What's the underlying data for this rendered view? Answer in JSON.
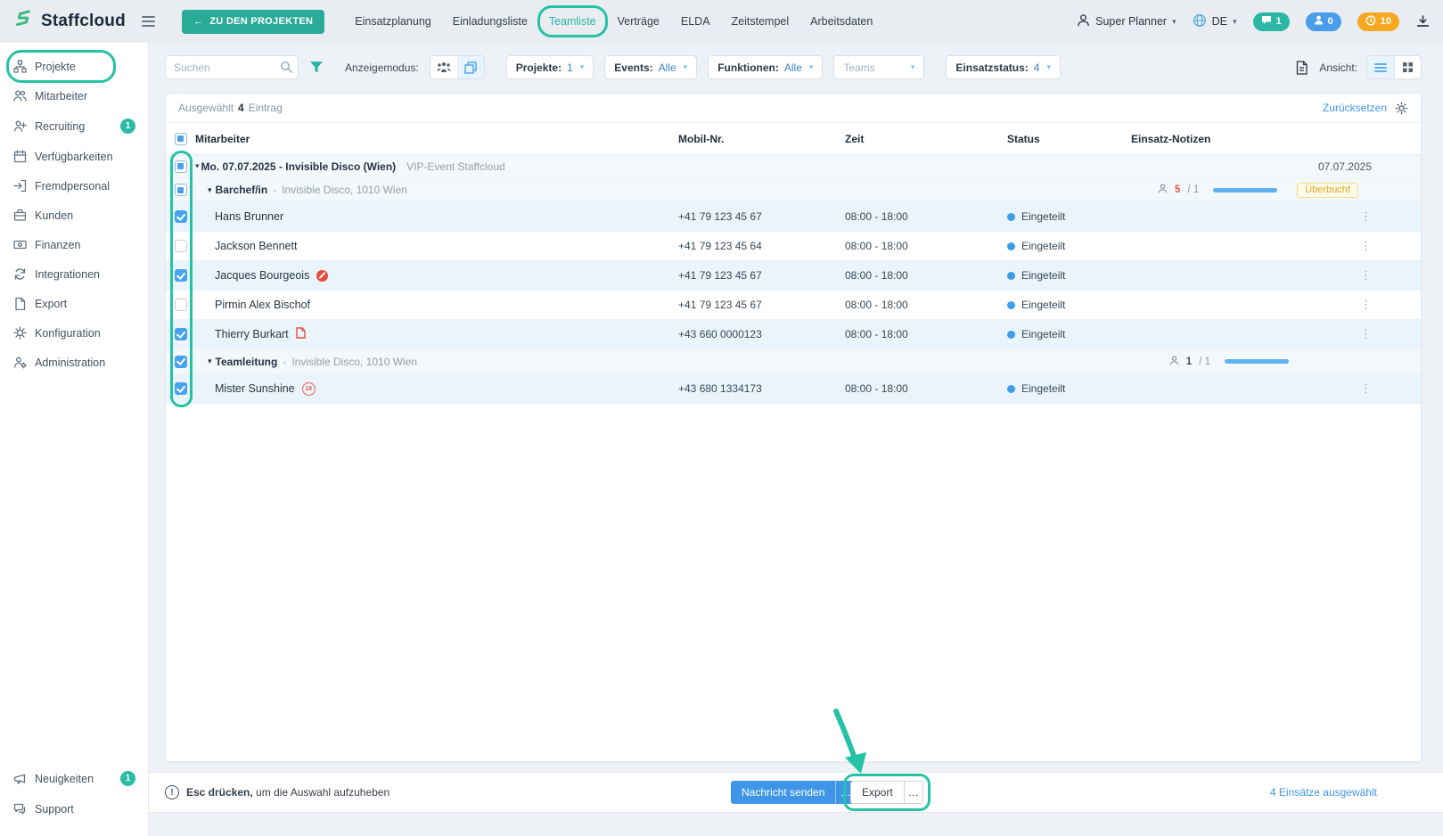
{
  "colors": {
    "accent_teal": "#27b9a3",
    "accent_blue": "#3f96e8",
    "accent_orange": "#f6a623",
    "annotation": "#25c2a5",
    "status_dot": "#3e9de8",
    "danger": "#e45c49"
  },
  "topbar": {
    "brand": "Staffcloud",
    "back_button": "ZU DEN PROJEKTEN",
    "tabs": [
      {
        "label": "Einsatzplanung"
      },
      {
        "label": "Einladungsliste"
      },
      {
        "label": "Teamliste"
      },
      {
        "label": "Verträge"
      },
      {
        "label": "ELDA"
      },
      {
        "label": "Zeitstempel"
      },
      {
        "label": "Arbeitsdaten"
      }
    ],
    "user": "Super Planner",
    "language": "DE",
    "badge_chat": "1",
    "badge_person": "0",
    "badge_clock": "10"
  },
  "sidebar": {
    "items": [
      {
        "label": "Projekte"
      },
      {
        "label": "Mitarbeiter"
      },
      {
        "label": "Recruiting",
        "badge": "1"
      },
      {
        "label": "Verfügbarkeiten"
      },
      {
        "label": "Fremdpersonal"
      },
      {
        "label": "Kunden"
      },
      {
        "label": "Finanzen"
      },
      {
        "label": "Integrationen"
      },
      {
        "label": "Export"
      },
      {
        "label": "Konfiguration"
      },
      {
        "label": "Administration"
      }
    ],
    "bottom_items": [
      {
        "label": "Neuigkeiten",
        "badge": "1"
      },
      {
        "label": "Support"
      }
    ]
  },
  "toolbar": {
    "search_placeholder": "Suchen",
    "display_mode_label": "Anzeigemodus:",
    "chip_projekte_label": "Projekte:",
    "chip_projekte_value": "1",
    "chip_events_label": "Events:",
    "chip_events_value": "Alle",
    "chip_funktionen_label": "Funktionen:",
    "chip_funktionen_value": "Alle",
    "chip_teams_placeholder": "Teams",
    "chip_status_label": "Einsatzstatus:",
    "chip_status_value": "4",
    "view_label": "Ansicht:"
  },
  "card": {
    "selected_label": "Ausgewählt",
    "selected_count": "4",
    "selected_unit": "Eintrag",
    "reset_link": "Zurücksetzen"
  },
  "table": {
    "header_cb": "indeterminate",
    "col_mitarbeiter": "Mitarbeiter",
    "col_mobil": "Mobil-Nr.",
    "col_zeit": "Zeit",
    "col_status": "Status",
    "col_notizen": "Einsatz-Notizen",
    "event": {
      "cb": "indeterminate",
      "title": "Mo. 07.07.2025 - Invisible Disco (Wien)",
      "subtitle": "VIP-Event Staffcloud",
      "date": "07.07.2025"
    },
    "groups": [
      {
        "cb": "indeterminate",
        "name": "Barchef/in",
        "sep": "-",
        "location": "Invisible Disco, 1010 Wien",
        "count": "5",
        "of": "/ 1",
        "badge": "Überbucht"
      },
      {
        "cb": "checked",
        "name": "Teamleitung",
        "sep": "-",
        "location": "Invisible Disco, 1010 Wien",
        "count": "1",
        "of": "/ 1"
      }
    ],
    "rows": [
      {
        "cb": "checked",
        "name": "Hans Brunner",
        "phone": "+41 79 123 45 67",
        "time": "08:00 - 18:00",
        "status": "Eingeteilt"
      },
      {
        "cb": "unchecked",
        "name": "Jackson Bennett",
        "phone": "+41 79 123 45 64",
        "time": "08:00 - 18:00",
        "status": "Eingeteilt"
      },
      {
        "cb": "checked",
        "name": "Jacques Bourgeois",
        "phone": "+41 79 123 45 67",
        "time": "08:00 - 18:00",
        "status": "Eingeteilt"
      },
      {
        "cb": "unchecked",
        "name": "Pirmin Alex Bischof",
        "phone": "+41 79 123 45 67",
        "time": "08:00 - 18:00",
        "status": "Eingeteilt"
      },
      {
        "cb": "checked",
        "name": "Thierry Burkart",
        "phone": "+43 660 0000123",
        "time": "08:00 - 18:00",
        "status": "Eingeteilt"
      },
      {
        "cb": "checked",
        "name": "Mister Sunshine",
        "icon_text": "18",
        "phone": "+43 680 1334173",
        "time": "08:00 - 18:00",
        "status": "Eingeteilt"
      }
    ]
  },
  "footer": {
    "hint_strong": "Esc drücken,",
    "hint_rest": "um die Auswahl aufzuheben",
    "send_button": "Nachricht senden",
    "send_more": "…",
    "export_button": "Export",
    "export_more": "…",
    "selected_info": "4 Einsätze ausgewählt"
  }
}
